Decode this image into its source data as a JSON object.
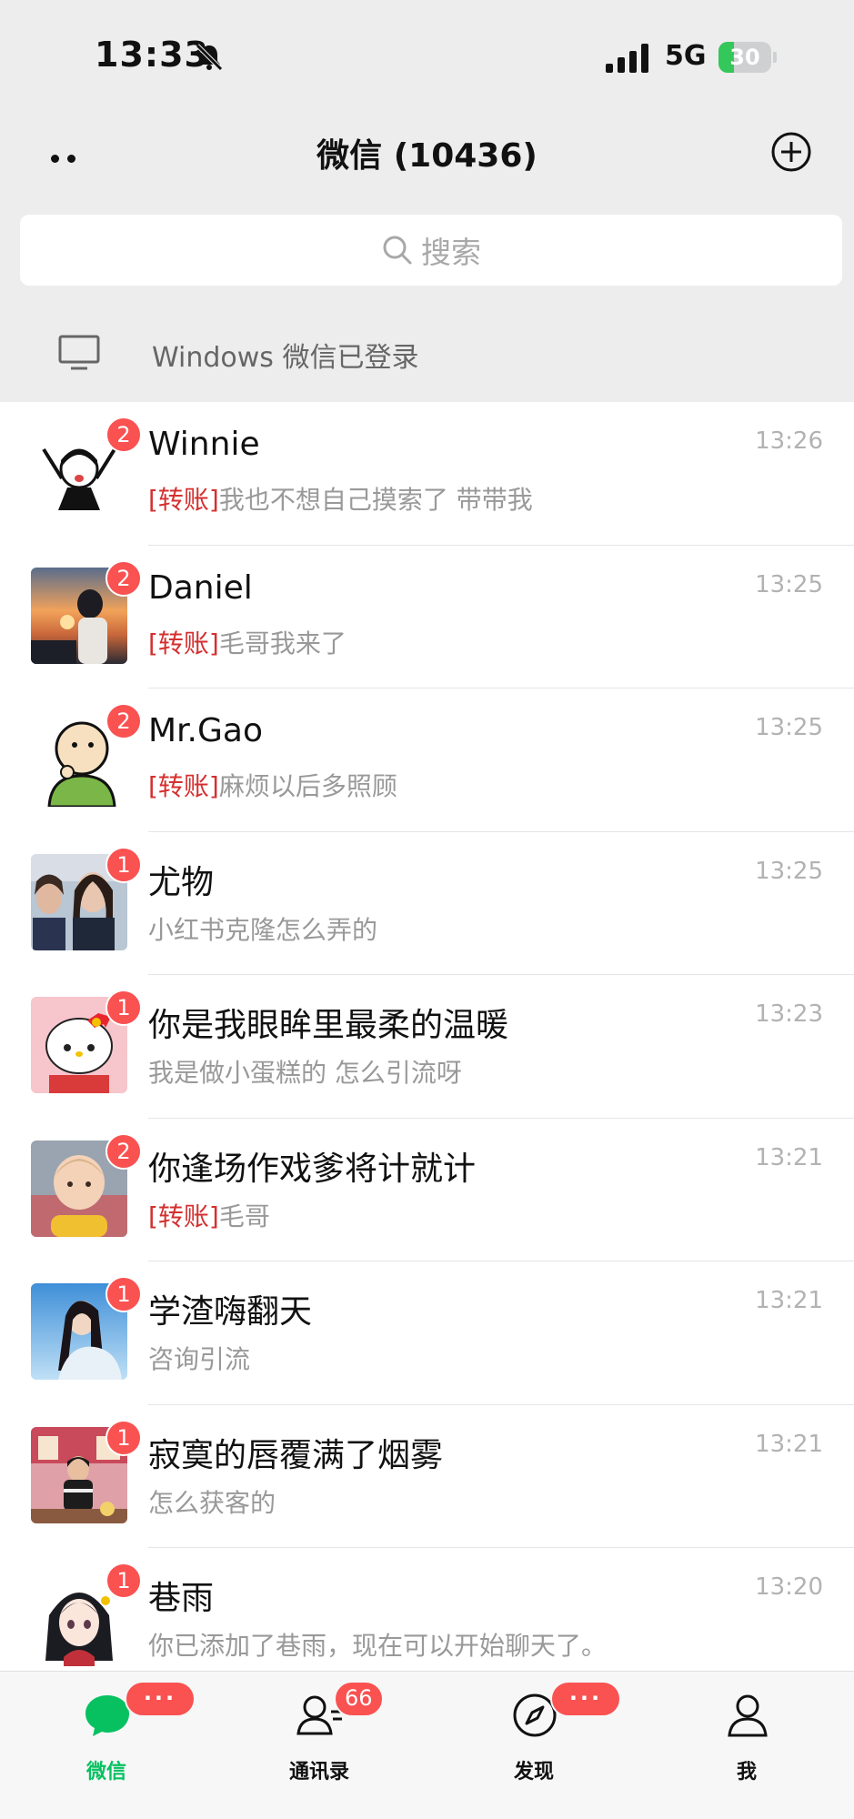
{
  "status_bar": {
    "time": "13:33",
    "network": "5G",
    "battery": "30",
    "battery_level": 0.3
  },
  "header": {
    "title": "微信 (10436)"
  },
  "search": {
    "placeholder": "搜索"
  },
  "login_banner": {
    "text": "Windows 微信已登录"
  },
  "chats": [
    {
      "name": "Winnie",
      "tag": "[转账]",
      "preview": "我也不想自己摸索了 带带我",
      "time": "13:26",
      "unread": "2",
      "avatar": "cartoon-girl-cheering"
    },
    {
      "name": "Daniel",
      "tag": "[转账]",
      "preview": "毛哥我来了",
      "time": "13:25",
      "unread": "2",
      "avatar": "sunset-photo"
    },
    {
      "name": "Mr.Gao",
      "tag": "[转账]",
      "preview": "麻烦以后多照顾",
      "time": "13:25",
      "unread": "2",
      "avatar": "cartoon-thinking-man"
    },
    {
      "name": "尤物",
      "tag": "",
      "preview": "小红书克隆怎么弄的",
      "time": "13:25",
      "unread": "1",
      "avatar": "two-girls-photo"
    },
    {
      "name": "你是我眼眸里最柔的温暖",
      "tag": "",
      "preview": "我是做小蛋糕的 怎么引流呀",
      "time": "13:23",
      "unread": "1",
      "avatar": "hello-kitty"
    },
    {
      "name": "你逢场作戏爹将计就计",
      "tag": "[转账]",
      "preview": "毛哥",
      "time": "13:21",
      "unread": "2",
      "avatar": "toddler-photo"
    },
    {
      "name": "学渣嗨翻天",
      "tag": "",
      "preview": "咨询引流",
      "time": "13:21",
      "unread": "1",
      "avatar": "girl-sky-photo"
    },
    {
      "name": "寂寞的唇覆满了烟雾",
      "tag": "",
      "preview": "怎么获客的",
      "time": "13:21",
      "unread": "1",
      "avatar": "person-street-photo"
    },
    {
      "name": "巷雨",
      "tag": "",
      "preview": "你已添加了巷雨，现在可以开始聊天了。",
      "time": "13:20",
      "unread": "1",
      "avatar": "anime-girl"
    }
  ],
  "tabs": [
    {
      "label": "微信",
      "badge": "···",
      "icon": "chat-bubble-icon",
      "active": true
    },
    {
      "label": "通讯录",
      "badge": "66",
      "icon": "contacts-icon",
      "active": false
    },
    {
      "label": "发现",
      "badge": "···",
      "icon": "compass-icon",
      "active": false
    },
    {
      "label": "我",
      "badge": "",
      "icon": "person-icon",
      "active": false
    }
  ],
  "colors": {
    "accent": "#07c160",
    "badge": "#fa5151",
    "transfer_tag": "#d43030",
    "battery": "#34c759"
  }
}
